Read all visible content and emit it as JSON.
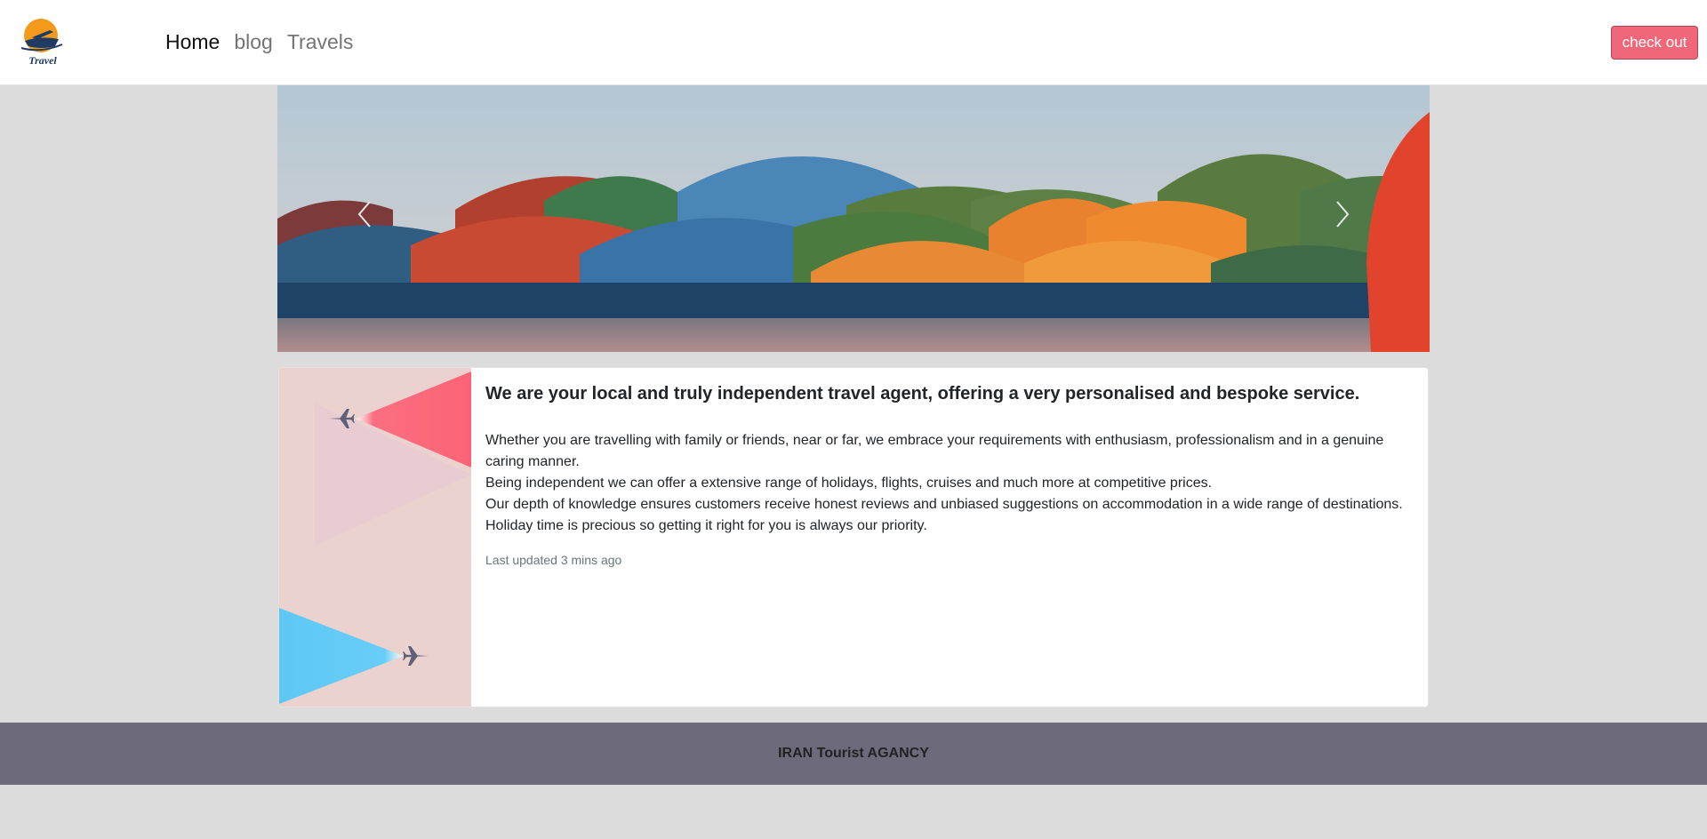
{
  "navbar": {
    "logo_text": "Travel",
    "links": [
      {
        "label": "Home",
        "active": true
      },
      {
        "label": "blog",
        "active": false
      },
      {
        "label": "Travels",
        "active": false
      }
    ],
    "checkout_label": "check out"
  },
  "card": {
    "title": "We are your local and truly independent travel agent, offering a very personalised and bespoke service.",
    "paragraphs": [
      "Whether you are travelling with family or friends, near or far, we embrace your requirements with enthusiasm, professionalism and in a genuine caring manner.",
      "Being independent we can offer a extensive range of holidays, flights, cruises and much more at competitive prices.",
      "Our depth of knowledge ensures customers receive honest reviews and unbiased suggestions on accommodation in a wide range of destinations. Holiday time is precious so getting it right for you is always our priority."
    ],
    "updated": "Last updated 3 mins ago"
  },
  "footer": {
    "text": "IRAN Tourist AGANCY"
  },
  "colors": {
    "accent": "#f0677a",
    "footer_bg": "#6d6a7c",
    "page_bg": "#dcdcdc"
  }
}
